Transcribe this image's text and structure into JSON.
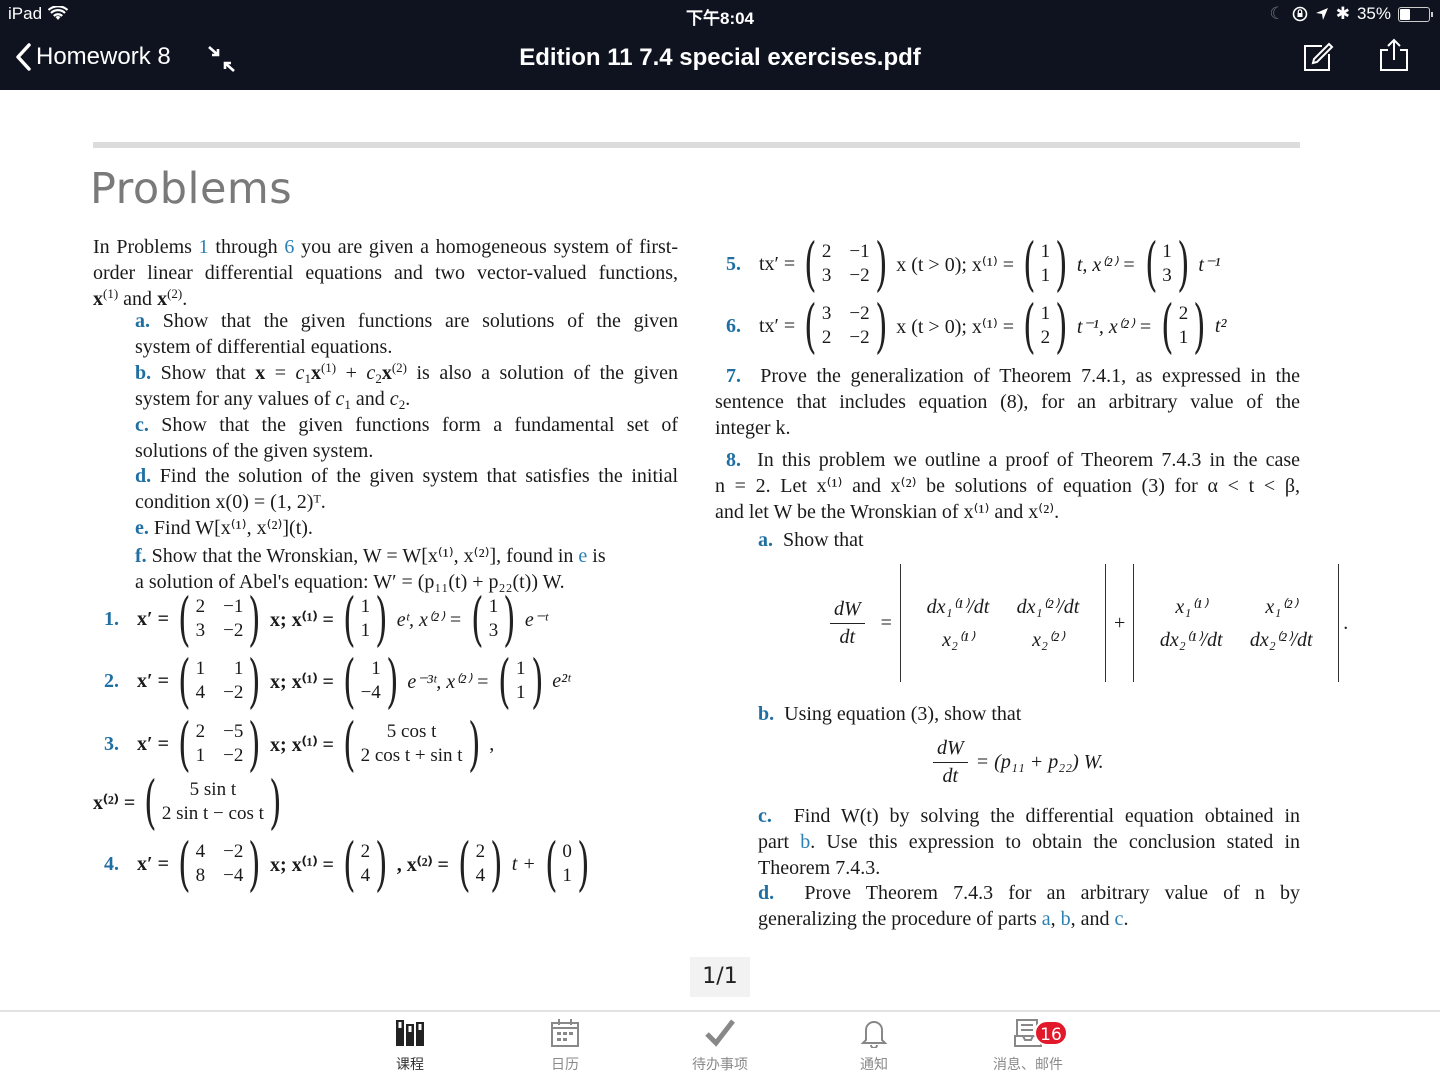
{
  "status_bar": {
    "device": "iPad",
    "time": "下午8:04",
    "battery": "35%",
    "battery_level": 0.35
  },
  "nav": {
    "back_label": "Homework 8",
    "title": "Edition 11 7.4 special exercises.pdf"
  },
  "document": {
    "heading": "Problems",
    "intro": {
      "t1": "In Problems ",
      "link1": "1",
      "t2": " through ",
      "link2": "6",
      "t3": " you are given a homogeneous system of first-",
      "line2": "order linear differential equations and two vector-valued functions,",
      "line3_and": " and "
    },
    "parts": {
      "a_label": "a.",
      "a_line1": "Show that the given functions are solutions of the given",
      "a_line2": "system of differential equations.",
      "b_label": "b.",
      "b_t1": "Show that ",
      "b_t2": " is also a solution of the given",
      "b_line2a": "system for any values of ",
      "b_line2b": " and ",
      "c_label": "c.",
      "c_line1": "Show that the given functions form a fundamental set of",
      "c_line2": "solutions of the given system.",
      "d_label": "d.",
      "d_line1": "Find the solution of the given system that satisfies the initial",
      "d_line2": "condition x(0) = (1, 2)ᵀ.",
      "e_label": "e.",
      "e_text": "Find W[x⁽¹⁾, x⁽²⁾](t).",
      "f_label": "f.",
      "f_t1": "Show that the Wronskian, W = W[x⁽¹⁾, x⁽²⁾], found in ",
      "f_link": "e",
      "f_t2": " is",
      "f_line2": "a solution of Abel's equation: W′ = (p₁₁(t) + p₂₂(t)) W."
    },
    "problems": [
      {
        "num": "1.",
        "lhs": "x′ =",
        "A": [
          "2",
          "−1",
          "3",
          "−2"
        ],
        "mid": "x; x⁽¹⁾ =",
        "v1": [
          "1",
          "1"
        ],
        "f1": "eᵗ, x⁽²⁾ =",
        "v2": [
          "1",
          "3"
        ],
        "f2": "e⁻ᵗ"
      },
      {
        "num": "2.",
        "lhs": "x′ =",
        "A": [
          "1",
          "1",
          "4",
          "−2"
        ],
        "mid": "x; x⁽¹⁾ =",
        "v1": [
          "1",
          "−4"
        ],
        "f1": "e⁻³ᵗ, x⁽²⁾ =",
        "v2": [
          "1",
          "1"
        ],
        "f2": "e²ᵗ"
      },
      {
        "num": "3.",
        "lhs": "x′ =",
        "A": [
          "2",
          "−5",
          "1",
          "−2"
        ],
        "mid": "x; x⁽¹⁾ =",
        "v1": [
          "5 cos t",
          "2 cos t + sin t"
        ],
        "f1": ",",
        "x2_lhs": "x⁽²⁾ =",
        "v2": [
          "5 sin t",
          "2 sin t − cos t"
        ]
      },
      {
        "num": "4.",
        "lhs": "x′ =",
        "A": [
          "4",
          "−2",
          "8",
          "−4"
        ],
        "mid": "x; x⁽¹⁾ =",
        "v1": [
          "2",
          "4"
        ],
        "f1": ", x⁽²⁾ =",
        "v2": [
          "2",
          "4"
        ],
        "f2": "t +",
        "v3": [
          "0",
          "1"
        ]
      },
      {
        "num": "5.",
        "lhs": "tx′ =",
        "A": [
          "2",
          "−1",
          "3",
          "−2"
        ],
        "mid": "x  (t > 0); x⁽¹⁾ =",
        "v1": [
          "1",
          "1"
        ],
        "f1": "t, x⁽²⁾ =",
        "v2": [
          "1",
          "3"
        ],
        "f2": "t⁻¹"
      },
      {
        "num": "6.",
        "lhs": "tx′ =",
        "A": [
          "3",
          "−2",
          "2",
          "−2"
        ],
        "mid": "x  (t > 0); x⁽¹⁾ =",
        "v1": [
          "1",
          "2"
        ],
        "f1": "t⁻¹, x⁽²⁾ =",
        "v2": [
          "2",
          "1"
        ],
        "f2": "t²"
      }
    ],
    "p7": {
      "num": "7.",
      "line1": "Prove the generalization of Theorem 7.4.1, as expressed in the",
      "line2": "sentence that includes equation (8), for an arbitrary value of the",
      "line3": "integer k."
    },
    "p8": {
      "num": "8.",
      "line1": "In this problem we outline a proof of Theorem 7.4.3 in the case",
      "line2": "n = 2. Let x⁽¹⁾ and x⁽²⁾ be solutions of equation (3) for α < t < β,",
      "line3": "and let W be the Wronskian of x⁽¹⁾ and x⁽²⁾.",
      "a_label": "a.",
      "a_text": "Show that",
      "eq_a": {
        "lhs_top": "dW",
        "lhs_bot": "dt",
        "eq": "=",
        "plus": "+",
        "end": ".",
        "d1": [
          "dx₁⁽¹⁾/dt",
          "dx₁⁽²⁾/dt",
          "x₂⁽¹⁾",
          "x₂⁽²⁾"
        ],
        "d2": [
          "x₁⁽¹⁾",
          "x₁⁽²⁾",
          "dx₂⁽¹⁾/dt",
          "dx₂⁽²⁾/dt"
        ]
      },
      "b_label": "b.",
      "b_text": "Using equation (3), show that",
      "eq_b": {
        "lhs_top": "dW",
        "lhs_bot": "dt",
        "rhs": "= (p₁₁ + p₂₂) W."
      },
      "c_label": "c.",
      "c_line1": "Find W(t) by solving the differential equation obtained in",
      "c_line2a": "part ",
      "c_link": "b",
      "c_line2b": ". Use this expression to obtain the conclusion stated in",
      "c_line3": "Theorem 7.4.3.",
      "d_label": "d.",
      "d_line1": "Prove Theorem 7.4.3 for an arbitrary value of n by",
      "d_line2a": "generalizing the procedure of parts ",
      "d_link_a": "a",
      "d_sep1": ", ",
      "d_link_b": "b",
      "d_sep2": ", and ",
      "d_link_c": "c",
      "d_end": "."
    }
  },
  "pager": {
    "label": "1/1",
    "current": 1,
    "total": 1
  },
  "tabbar": {
    "tabs": [
      {
        "label": "课程",
        "icon": "courses-icon",
        "active": true
      },
      {
        "label": "日历",
        "icon": "calendar-icon"
      },
      {
        "label": "待办事项",
        "icon": "checkmark-icon"
      },
      {
        "label": "通知",
        "icon": "bell-icon"
      },
      {
        "label": "消息、邮件",
        "icon": "inbox-icon",
        "badge": "16"
      }
    ]
  },
  "colors": {
    "nav_bg": "#0f1320",
    "link_blue": "#2b7fb3",
    "label_blue": "#1f6fa3",
    "badge_red": "#e1192a"
  }
}
